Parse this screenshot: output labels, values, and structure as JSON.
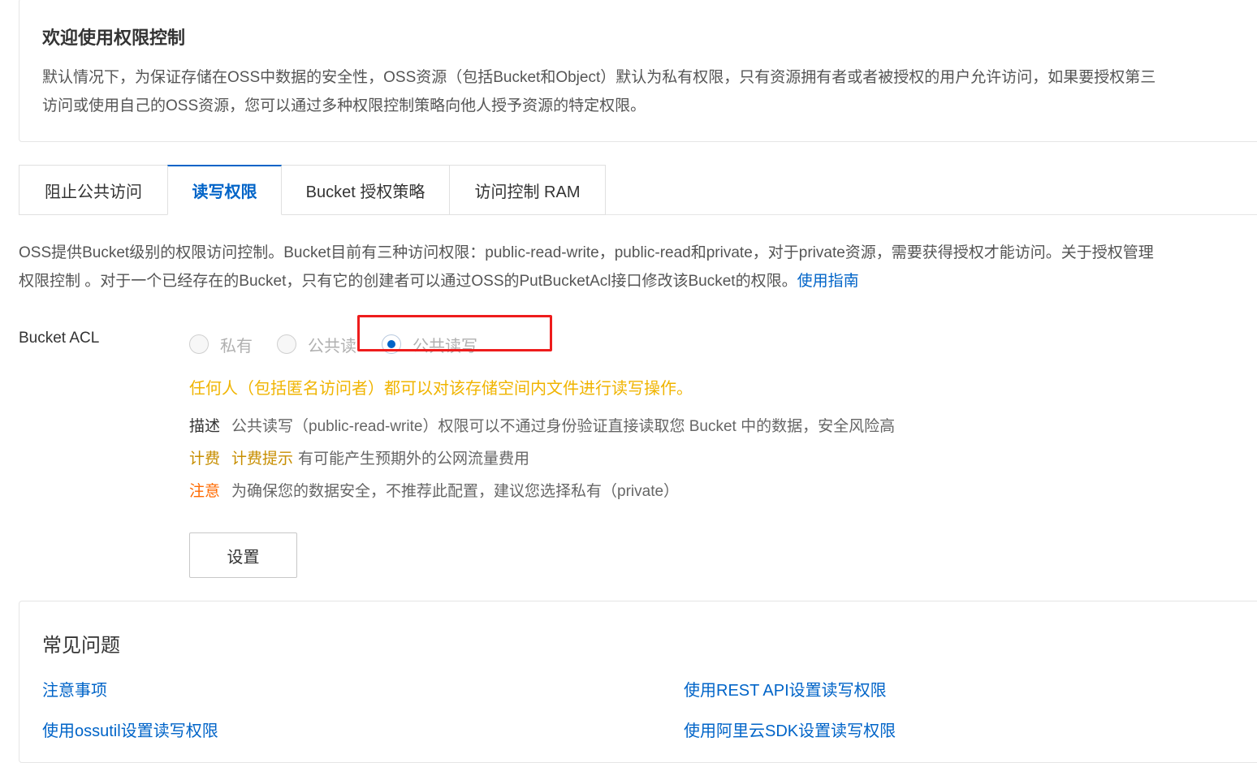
{
  "welcome": {
    "title": "欢迎使用权限控制",
    "desc_line1": "默认情况下，为保证存储在OSS中数据的安全性，OSS资源（包括Bucket和Object）默认为私有权限，只有资源拥有者或者被授权的用户允许访问，如果要授权第三",
    "desc_line2": "访问或使用自己的OSS资源，您可以通过多种权限控制策略向他人授予资源的特定权限。"
  },
  "tabs": [
    {
      "label": "阻止公共访问",
      "active": false
    },
    {
      "label": "读写权限",
      "active": true
    },
    {
      "label": "Bucket 授权策略",
      "active": false
    },
    {
      "label": "访问控制 RAM",
      "active": false
    }
  ],
  "intro": {
    "line1": "OSS提供Bucket级别的权限访问控制。Bucket目前有三种访问权限：public-read-write，public-read和private，对于private资源，需要获得授权才能访问。关于授权管理",
    "line2_text": "权限控制 。对于一个已经存在的Bucket，只有它的创建者可以通过OSS的PutBucketAcl接口修改该Bucket的权限。",
    "guide_link": "使用指南"
  },
  "acl": {
    "label": "Bucket ACL",
    "options": [
      {
        "label": "私有",
        "checked": false
      },
      {
        "label": "公共读",
        "checked": false
      },
      {
        "label": "公共读写",
        "checked": true
      }
    ],
    "warning": "任何人（包括匿名访问者）都可以对该存储空间内文件进行读写操作。",
    "description_key": "描述",
    "description_value": "公共读写（public-read-write）权限可以不通过身份验证直接读取您 Bucket 中的数据，安全风险高",
    "fee_key": "计费",
    "fee_hint": "计费提示",
    "fee_value": "有可能产生预期外的公网流量费用",
    "note_key": "注意",
    "note_value": "为确保您的数据安全，不推荐此配置，建议您选择私有（private）",
    "set_button": "设置"
  },
  "faq": {
    "title": "常见问题",
    "links": [
      "注意事项",
      "使用REST API设置读写权限",
      "使用ossutil设置读写权限",
      "使用阿里云SDK设置读写权限"
    ]
  },
  "colors": {
    "accent": "#0064c8",
    "warning": "#f0b400",
    "fee": "#c78e00",
    "note": "#ff6a00",
    "highlight": "#ee1c1c"
  }
}
